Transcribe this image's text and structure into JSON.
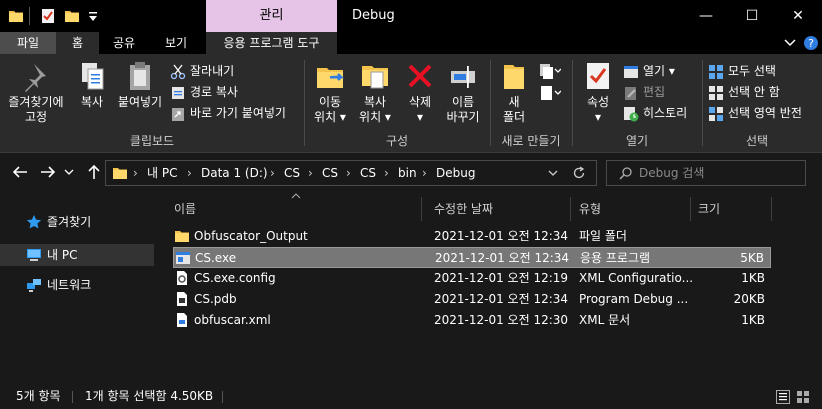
{
  "titlebar": {
    "manage_tab": "관리",
    "title": "Debug",
    "minimize_glyph": "—",
    "maximize_glyph": "☐",
    "close_glyph": "✕"
  },
  "tabs": {
    "file": "파일",
    "home": "홈",
    "share": "공유",
    "view": "보기",
    "app_tools": "응용 프로그램 도구"
  },
  "ribbon": {
    "clipboard": {
      "pin": "즐겨찾기에\n고정",
      "copy": "복사",
      "paste": "붙여넣기",
      "cut": "잘라내기",
      "copy_path": "경로 복사",
      "paste_shortcut": "바로 가기 붙여넣기",
      "label": "클립보드"
    },
    "organize": {
      "move_to": "이동\n위치 ▾",
      "copy_to": "복사\n위치 ▾",
      "delete": "삭제\n▾",
      "rename": "이름\n바꾸기",
      "label": "구성"
    },
    "new": {
      "new_folder": "새\n폴더",
      "label": "새로 만들기"
    },
    "open": {
      "properties": "속성\n▾",
      "open": "열기 ▾",
      "edit": "편집",
      "history": "히스토리",
      "label": "열기"
    },
    "select": {
      "select_all": "모두 선택",
      "select_none": "선택 안 함",
      "invert": "선택 영역 반전",
      "label": "선택"
    }
  },
  "address": {
    "crumbs": [
      "내 PC",
      "Data 1 (D:)",
      "CS",
      "CS",
      "CS",
      "bin",
      "Debug"
    ],
    "search_placeholder": "Debug 검색"
  },
  "nav": {
    "quick_access": "즐겨찾기",
    "this_pc": "내 PC",
    "network": "네트워크"
  },
  "columns": {
    "name": "이름",
    "date": "수정한 날짜",
    "type": "유형",
    "size": "크기"
  },
  "files": [
    {
      "name": "Obfuscator_Output",
      "date": "2021-12-01 오전 12:34",
      "type": "파일 폴더",
      "size": "",
      "icon": "folder-icon"
    },
    {
      "name": "CS.exe",
      "date": "2021-12-01 오전 12:34",
      "type": "응용 프로그램",
      "size": "5KB",
      "icon": "exe-icon"
    },
    {
      "name": "CS.exe.config",
      "date": "2021-12-01 오전 12:19",
      "type": "XML Configuratio...",
      "size": "1KB",
      "icon": "config-file-icon"
    },
    {
      "name": "CS.pdb",
      "date": "2021-12-01 오전 12:34",
      "type": "Program Debug ...",
      "size": "20KB",
      "icon": "pdb-file-icon"
    },
    {
      "name": "obfuscar.xml",
      "date": "2021-12-01 오전 12:30",
      "type": "XML 문서",
      "size": "1KB",
      "icon": "xml-file-icon"
    }
  ],
  "status": {
    "count": "5개 항목",
    "selected": "1개 항목 선택함 4.50KB"
  },
  "colors": {
    "manage_tab": "#e5c4e7",
    "background": "#191919",
    "ribbon": "#2b2b2b",
    "selection": "#777777",
    "folder": "#f3c34c"
  }
}
